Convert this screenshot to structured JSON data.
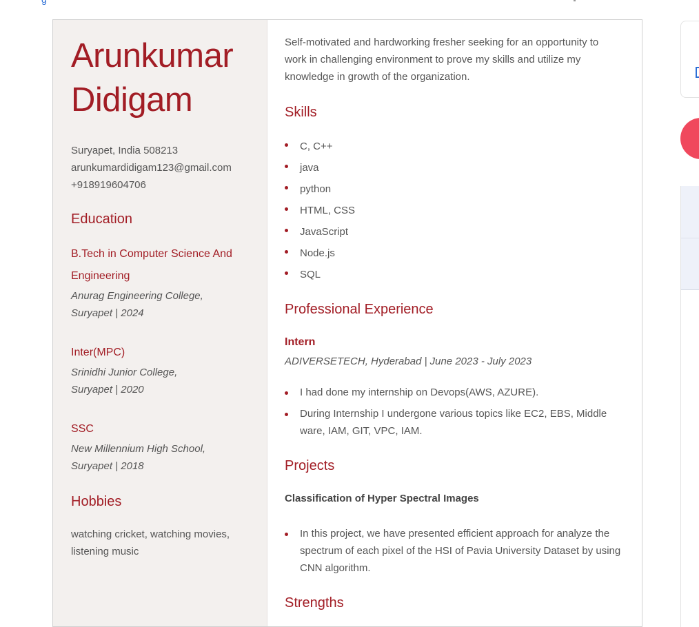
{
  "resume": {
    "name_line1": "Arunkumar",
    "name_line2": "Didigam",
    "contact": {
      "address": "Suryapet, India 508213",
      "email": "arunkumardidigam123@gmail.com",
      "phone": "+918919604706"
    },
    "education_heading": "Education",
    "education": [
      {
        "degree_line1": "B.Tech in Computer Science And",
        "degree_line2": "Engineering",
        "school_line1": "Anurag Engineering College,",
        "school_line2": "Suryapet | 2024"
      },
      {
        "degree_line1": "Inter(MPC)",
        "school_line1": "Srinidhi Junior College,",
        "school_line2": "Suryapet | 2020"
      },
      {
        "degree_line1": "SSC",
        "school_line1": "New Millennium High School,",
        "school_line2": "Suryapet | 2018"
      }
    ],
    "hobbies_heading": "Hobbies",
    "hobbies": "watching cricket, watching movies, listening music",
    "summary": "Self-motivated and hardworking fresher seeking for an opportunity to work in challenging environment to prove my skills and utilize my knowledge in growth of the organization.",
    "skills_heading": "Skills",
    "skills": [
      "C, C++",
      "java",
      "python",
      "HTML, CSS",
      "JavaScript",
      "Node.js",
      "SQL"
    ],
    "experience_heading": "Professional Experience",
    "job": {
      "title": "Intern",
      "meta": "ADIVERSETECH, Hyderabad | June 2023 - July 2023",
      "bullets": [
        "I had done my internship on Devops(AWS, AZURE).",
        "During Internship I undergone various topics like EC2, EBS, Middle ware, IAM, GIT, VPC, IAM."
      ]
    },
    "projects_heading": "Projects",
    "project": {
      "title": "Classification of Hyper Spectral Images",
      "bullets": [
        "In this project, we have presented efficient approach for analyze the spectrum of each pixel of the HSI of Pavia University Dataset by using CNN algorithm."
      ]
    },
    "strengths_heading": "Strengths"
  },
  "colors": {
    "accent": "#a21d25",
    "sidebar_bg": "#f3f0ee",
    "text": "#555555",
    "right_circle": "#f0485d",
    "link_blue": "#2d6fd6"
  }
}
